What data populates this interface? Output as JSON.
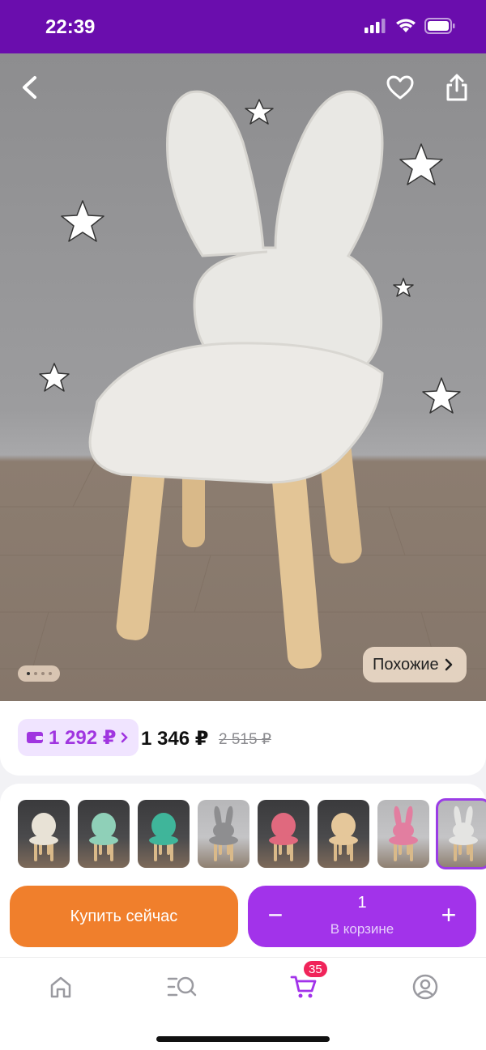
{
  "status_bar": {
    "time": "22:39"
  },
  "hero": {
    "similar_label": "Похожие",
    "page_count": 4,
    "current_page": 1
  },
  "price": {
    "card_price": "1 292 ₽",
    "price": "1 346 ₽",
    "old_price": "2 515 ₽"
  },
  "variants": [
    {
      "color": "#e8e2d6",
      "ears": false,
      "bg": "dark"
    },
    {
      "color": "#8fd0b8",
      "ears": false,
      "bg": "dark"
    },
    {
      "color": "#3fb59a",
      "ears": false,
      "bg": "dark"
    },
    {
      "color": "#8e8e90",
      "ears": true,
      "bg": "light"
    },
    {
      "color": "#e0697e",
      "ears": false,
      "bg": "dark"
    },
    {
      "color": "#e5c79a",
      "ears": false,
      "bg": "dark"
    },
    {
      "color": "#e27ea0",
      "ears": true,
      "bg": "light"
    },
    {
      "color": "#e4e4e2",
      "ears": true,
      "bg": "light",
      "selected": true
    }
  ],
  "actions": {
    "buy_now": "Купить сейчас",
    "quantity": "1",
    "in_cart": "В корзине",
    "minus": "−",
    "plus": "+"
  },
  "tab_bar": {
    "cart_badge": "35"
  },
  "colors": {
    "accent": "#a233ea",
    "buy": "#f07f2c",
    "status_bar": "#6a0dad",
    "badge": "#f0245a"
  }
}
